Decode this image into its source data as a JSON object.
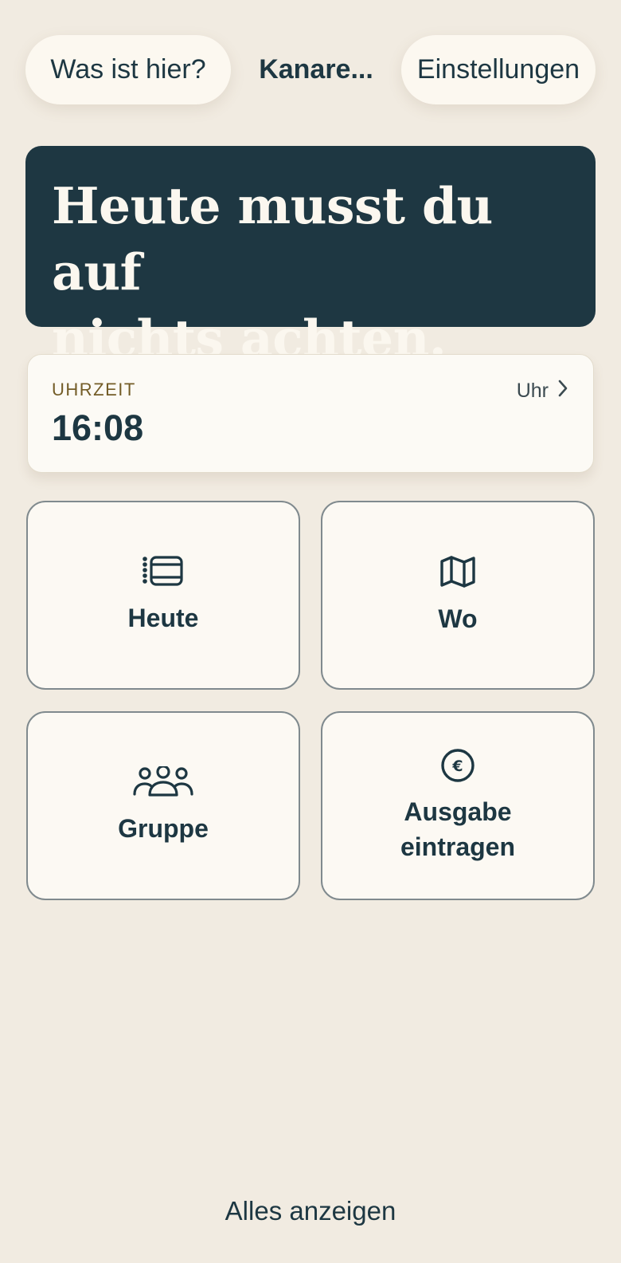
{
  "header": {
    "help_button": "Was ist hier?",
    "trip_title": "Kanare...",
    "settings_button": "Einstellungen"
  },
  "hero": {
    "message": "Heute musst du auf\nnichts achten."
  },
  "time_card": {
    "label": "UHRZEIT",
    "value": "16:08",
    "link_label": "Uhr",
    "link_icon": "chevron-right-icon"
  },
  "tiles": [
    {
      "label": "Heute",
      "icon": "list-schedule-icon"
    },
    {
      "label": "Wo",
      "icon": "map-icon"
    },
    {
      "label": "Gruppe",
      "icon": "group-icon"
    },
    {
      "label": "Ausgabe eintragen",
      "icon": "euro-coin-icon"
    }
  ],
  "footer": {
    "show_all": "Alles anzeigen"
  },
  "colors": {
    "background": "#f1ebe1",
    "hero_background": "#1e3742",
    "text_primary": "#1d3742",
    "accent_label": "#735c27",
    "card_background": "#fcf9f3"
  }
}
